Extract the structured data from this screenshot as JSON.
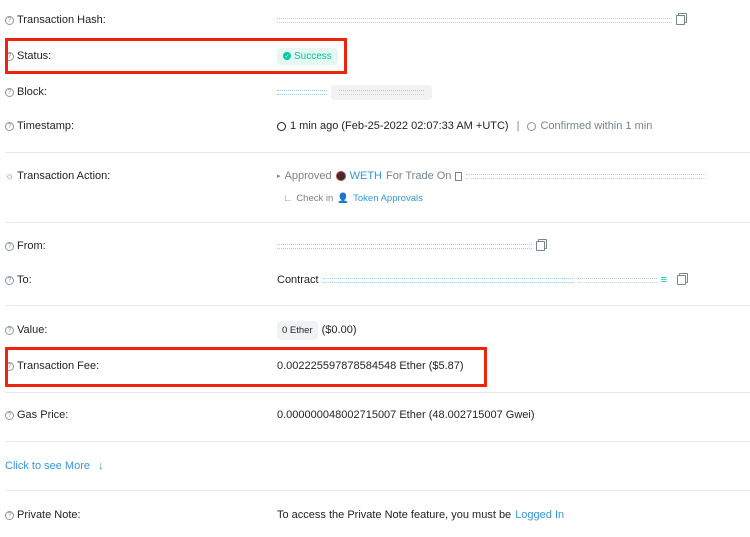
{
  "rows": {
    "hash": {
      "label": "Transaction Hash:"
    },
    "status": {
      "label": "Status:",
      "value": "Success",
      "icon": "check-circle-icon"
    },
    "block": {
      "label": "Block:"
    },
    "timestamp": {
      "label": "Timestamp:",
      "value": "1 min ago (Feb-25-2022 02:07:33 AM +UTC)",
      "separator": "|",
      "confirmed": "Confirmed within 1 min"
    },
    "action": {
      "label": "Transaction Action:",
      "approved": "Approved",
      "token": "WETH",
      "for_trade": "For Trade On",
      "check_in": "Check in",
      "approvals": "Token Approvals"
    },
    "from": {
      "label": "From:"
    },
    "to": {
      "label": "To:",
      "prefix": "Contract"
    },
    "value": {
      "label": "Value:",
      "amount": "0 Ether",
      "usd": "($0.00)"
    },
    "fee": {
      "label": "Transaction Fee:",
      "value": "0.002225597878584548 Ether ($5.87)"
    },
    "gas": {
      "label": "Gas Price:",
      "value": "0.000000048002715007 Ether (48.002715007 Gwei)"
    },
    "more": {
      "label": "Click to see More",
      "arrow": "↓"
    },
    "note": {
      "label": "Private Note:",
      "text": "To access the Private Note feature, you must be",
      "link": "Logged In"
    }
  },
  "colors": {
    "highlight": "#f0230d",
    "success": "#00c9a7",
    "link": "#3498db"
  }
}
